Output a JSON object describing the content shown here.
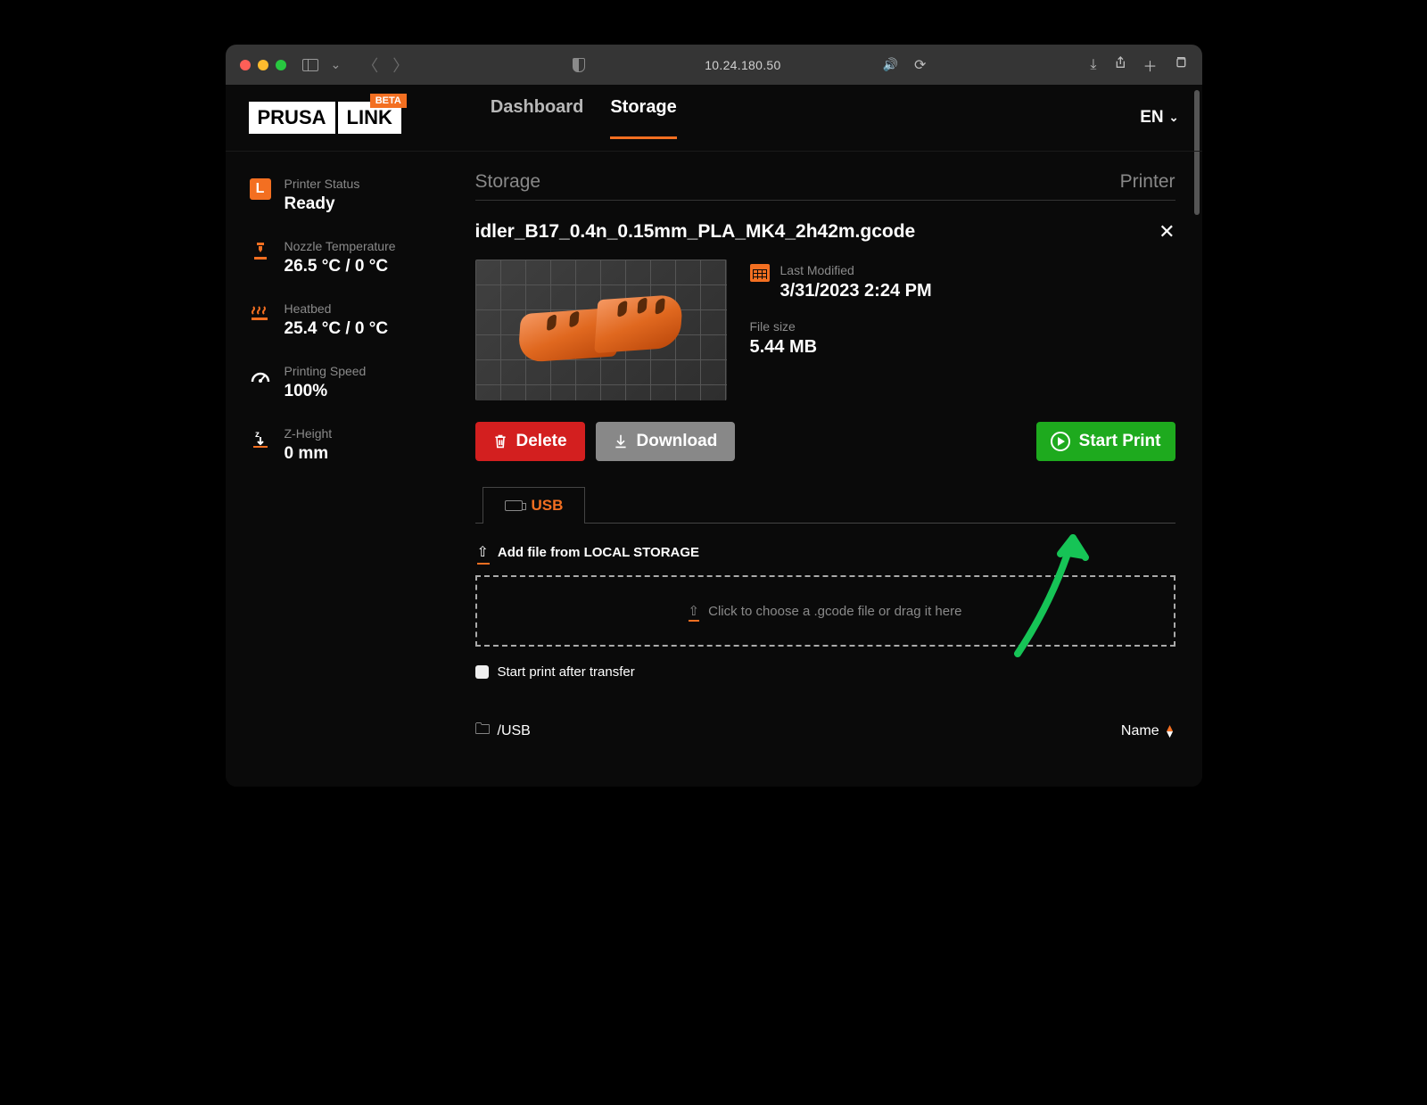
{
  "browser": {
    "url": "10.24.180.50"
  },
  "logo": {
    "a": "PRUSA",
    "b": "LINK",
    "beta": "BETA"
  },
  "nav": {
    "dashboard": "Dashboard",
    "storage": "Storage"
  },
  "lang": "EN",
  "sidebar": {
    "status_label": "Printer Status",
    "status_value": "Ready",
    "nozzle_label": "Nozzle Temperature",
    "nozzle_value": "26.5 °C / 0 °C",
    "bed_label": "Heatbed",
    "bed_value": "25.4 °C / 0 °C",
    "speed_label": "Printing Speed",
    "speed_value": "100%",
    "z_label": "Z-Height",
    "z_value": "0 mm"
  },
  "page": {
    "title": "Storage",
    "right": "Printer"
  },
  "file": {
    "name": "idler_B17_0.4n_0.15mm_PLA_MK4_2h42m.gcode",
    "modified_label": "Last Modified",
    "modified_value": "3/31/2023 2:24 PM",
    "size_label": "File size",
    "size_value": "5.44 MB"
  },
  "buttons": {
    "delete": "Delete",
    "download": "Download",
    "start": "Start Print"
  },
  "tab": {
    "usb": "USB"
  },
  "upload": {
    "add_label": "Add file from LOCAL STORAGE",
    "drop_hint": "Click to choose a .gcode file or drag it here",
    "checkbox": "Start print after transfer"
  },
  "listing": {
    "path": "/USB",
    "sort": "Name"
  }
}
